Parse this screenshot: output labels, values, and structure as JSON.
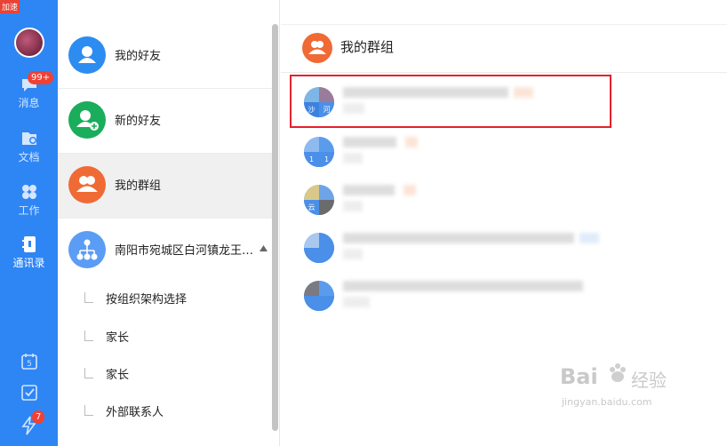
{
  "rail": {
    "top_badge": "加速",
    "items": [
      {
        "label": "消息",
        "icon": "chat-icon",
        "badge": "99+"
      },
      {
        "label": "文档",
        "icon": "folder-icon"
      },
      {
        "label": "工作",
        "icon": "grid-icon"
      },
      {
        "label": "通讯录",
        "icon": "contacts-book-icon",
        "active": true
      }
    ],
    "bottom": [
      {
        "icon": "calendar-icon",
        "text": "5"
      },
      {
        "icon": "checkbox-icon"
      },
      {
        "icon": "lightning-icon",
        "badge": "7"
      }
    ]
  },
  "contacts": {
    "rows": [
      {
        "label": "我的好友",
        "color": "#2d8cf0",
        "icon": "user-icon"
      },
      {
        "label": "新的好友",
        "color": "#1aad5b",
        "icon": "user-add-icon"
      },
      {
        "label": "我的群组",
        "color": "#f06a35",
        "icon": "group-icon",
        "selected": true
      },
      {
        "label": "南阳市宛城区白河镇龙王…",
        "color": "#5b9df5",
        "icon": "org-chart-icon"
      }
    ],
    "org_items": [
      "按组织架构选择",
      "家长",
      "家长",
      "外部联系人"
    ]
  },
  "groups_pane": {
    "title": "我的群组",
    "avatar_tiles": [
      "沙",
      "河",
      "1",
      "1",
      "云"
    ]
  },
  "watermark": {
    "brand": "Bai",
    "brand2": "经验",
    "url": "jingyan.baidu.com"
  }
}
